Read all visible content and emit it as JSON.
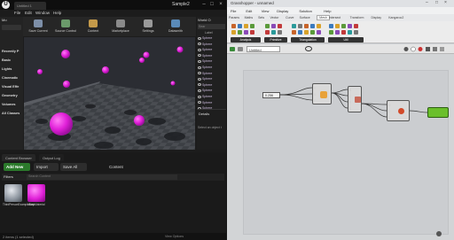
{
  "unreal": {
    "tab_title": "Untitled 1",
    "project_name": "Sample2",
    "menu": [
      "File",
      "Edit",
      "Window",
      "Help"
    ],
    "modes_header": "Mo",
    "modes": [
      "Recently P",
      "Basic",
      "Lights",
      "Cinematic",
      "Visual Effe",
      "Geometry",
      "Volumes",
      "All Classes"
    ],
    "toolbar": [
      {
        "label": "Save Current",
        "icon": "save-icon",
        "color": "#7d8fa8"
      },
      {
        "label": "Source Control",
        "icon": "source-control-icon",
        "color": "#6a9a6a"
      },
      {
        "label": "Content",
        "icon": "content-icon",
        "color": "#c49a4a"
      },
      {
        "label": "Marketplace",
        "icon": "marketplace-icon",
        "color": "#8a8a8a"
      },
      {
        "label": "Settings",
        "icon": "gear-icon",
        "color": "#9a9a9a"
      },
      {
        "label": "Datasmith",
        "icon": "datasmith-icon",
        "color": "#5a8ab8"
      }
    ],
    "outliner_header": "World O",
    "outliner_search": "Sear",
    "outliner_label": "Label",
    "outliner_rows": [
      "Sphere",
      "Sphere",
      "Sphere",
      "Sphere",
      "Sphere",
      "Sphere",
      "Sphere",
      "Sphere",
      "Sphere",
      "Sphere",
      "Sphere",
      "Sphere",
      "Sphere",
      "Sphere"
    ],
    "view_options": "View Optio",
    "details_tab": "Details",
    "details_hint": "Select an object t",
    "content_tabs": [
      "Content Browser",
      "Output Log"
    ],
    "add_new": "Add New",
    "import": "Import",
    "save_all": "Save All",
    "breadcrumb": "Content",
    "filters": "Filters",
    "search_placeholder": "Search Content",
    "assets": [
      {
        "label": "ThirdPersonExampleMap"
      },
      {
        "label": "MaskMaterial"
      }
    ],
    "status": "2 items (1 selected)",
    "view_options_bottom": "View Options",
    "colors": {
      "accent": "#2b7a2b",
      "sphere": "#e020d8"
    }
  },
  "grasshopper": {
    "title": "Grasshopper - unnamed",
    "menu": [
      "File",
      "Edit",
      "View",
      "Display",
      "Solution",
      "Help"
    ],
    "tabs": [
      "Params",
      "Maths",
      "Sets",
      "Vector",
      "Curve",
      "Surface",
      "Mesh",
      "Intersect",
      "Transform",
      "Display",
      "Kangaroo2"
    ],
    "active_tab": "Mesh",
    "groups": [
      "Analysis",
      "Primitive",
      "Triangulation",
      "Util"
    ],
    "document_name": "Untitled",
    "nodes": {
      "slider_value": "0.256",
      "node1_inputs": [
        "R",
        "S",
        "F"
      ],
      "node2_inputs": [
        "B",
        "C",
        "P",
        "S"
      ],
      "node3_inputs": [
        "M",
        "C",
        "S"
      ]
    }
  }
}
